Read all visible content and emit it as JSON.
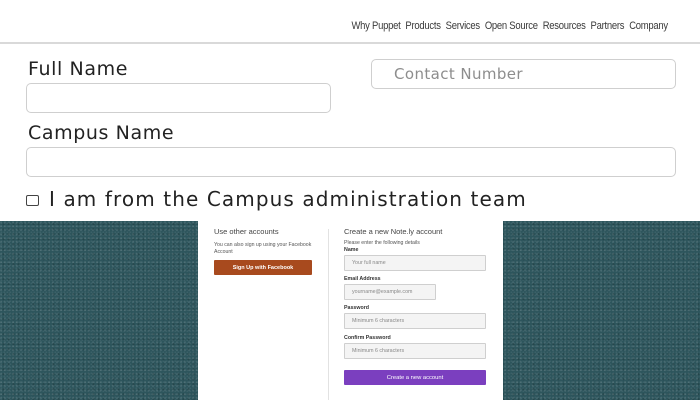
{
  "nav": {
    "items": [
      "Why Puppet",
      "Products",
      "Services",
      "Open Source",
      "Resources",
      "Partners",
      "Company"
    ]
  },
  "form": {
    "full_name_label": "Full Name",
    "full_name_value": "",
    "contact_number_placeholder": "Contact Number",
    "contact_number_value": "",
    "campus_name_label": "Campus Name",
    "campus_name_value": "",
    "campus_admin_checkbox_label": "I am from the Campus administration team",
    "campus_admin_checked": false
  },
  "signup": {
    "other_accounts_heading": "Use other accounts",
    "other_accounts_text": "You can also sign up using your Facebook Account",
    "facebook_button": "Sign Up with Facebook",
    "create_heading": "Create a new Note.ly account",
    "create_intro": "Please enter the following details",
    "name_label": "Name",
    "name_placeholder": "Your full name",
    "email_label": "Email Address",
    "email_placeholder": "yourname@example.com",
    "password_label": "Password",
    "password_placeholder": "Minimum 6 characters",
    "confirm_password_label": "Confirm Password",
    "confirm_password_placeholder": "Minimum 6 characters",
    "create_button": "Create a new account"
  },
  "colors": {
    "page_background_bottom": "#2d555c",
    "facebook_button": "#a84a1e",
    "create_button": "#7b3fbf"
  }
}
